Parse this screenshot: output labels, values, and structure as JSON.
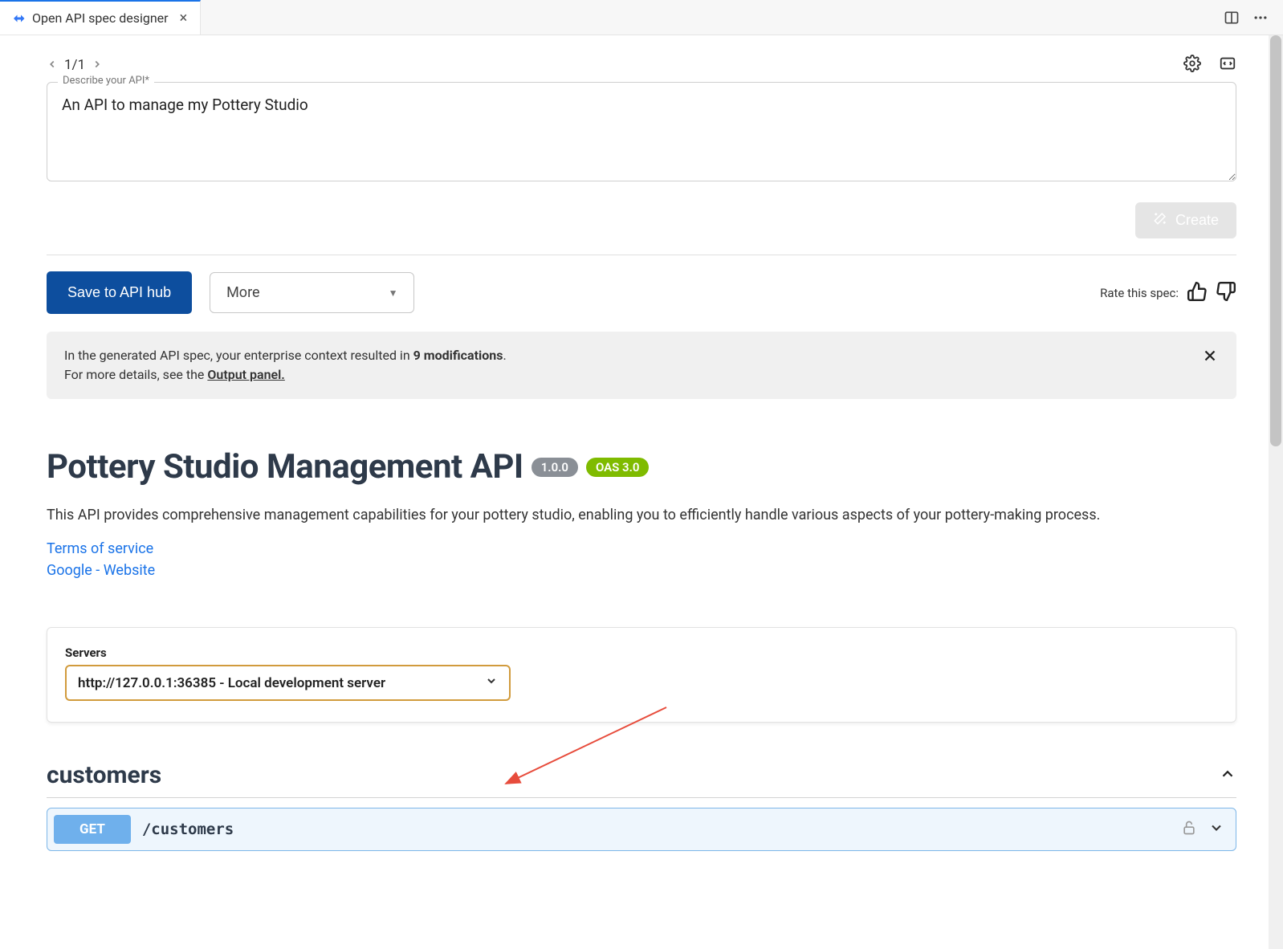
{
  "tab": {
    "title": "Open API spec designer"
  },
  "pagenav": {
    "position": "1/1"
  },
  "describe": {
    "label": "Describe your API*",
    "value": "An API to manage my Pottery Studio"
  },
  "buttons": {
    "create": "Create",
    "save": "Save to API hub",
    "more": "More"
  },
  "rate": {
    "label": "Rate this spec:"
  },
  "banner": {
    "line1_prefix": "In the generated API spec, your enterprise context resulted in ",
    "modifications": "9 modifications",
    "line1_suffix": ".",
    "line2_prefix": "For more details, see the ",
    "output_panel": "Output panel."
  },
  "api": {
    "title": "Pottery Studio Management API",
    "version": "1.0.0",
    "oas": "OAS 3.0",
    "description": "This API provides comprehensive management capabilities for your pottery studio, enabling you to efficiently handle various aspects of your pottery-making process.",
    "links": {
      "terms": "Terms of service",
      "website": "Google - Website"
    }
  },
  "servers": {
    "label": "Servers",
    "selected": "http://127.0.0.1:36385 - Local development server"
  },
  "endpoint": {
    "tag": "customers",
    "method": "GET",
    "path": "/customers"
  }
}
